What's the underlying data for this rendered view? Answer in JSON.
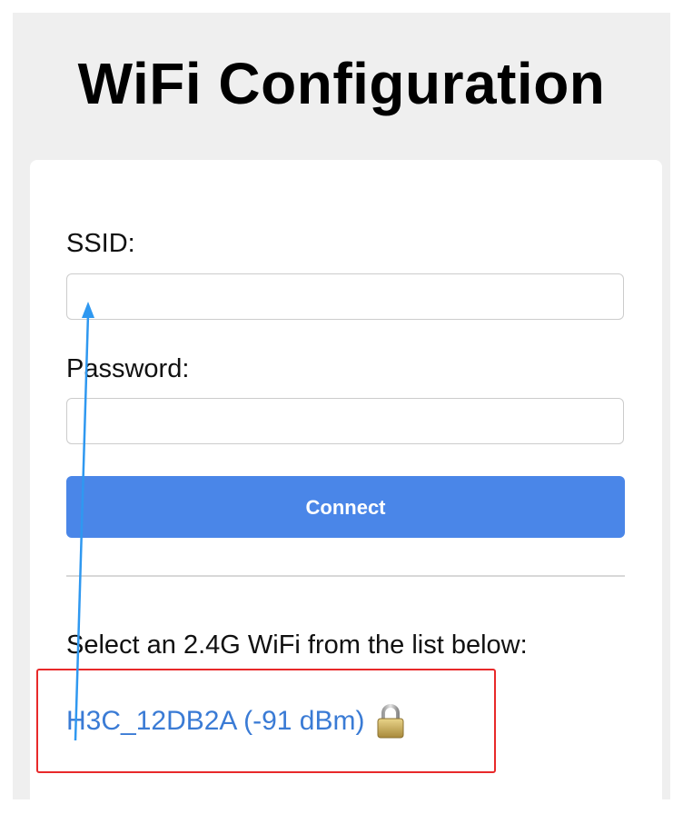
{
  "page": {
    "title": "WiFi Configuration"
  },
  "form": {
    "ssid_label": "SSID:",
    "ssid_value": "",
    "password_label": "Password:",
    "password_value": "",
    "connect_label": "Connect"
  },
  "networks": {
    "heading": "Select an 2.4G WiFi from the list below:",
    "items": [
      {
        "label": "H3C_12DB2A (-91 dBm)",
        "icon": "lock-icon",
        "secured": true
      }
    ]
  },
  "annotations": {
    "highlight_color": "#e8292a",
    "arrow_color": "#2f98f0"
  },
  "colors": {
    "page_background": "#efefef",
    "button": "#4a86e8",
    "link": "#3a7bd5"
  }
}
